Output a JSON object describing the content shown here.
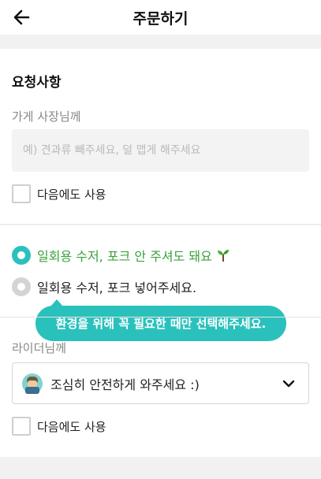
{
  "header": {
    "title": "주문하기",
    "back_icon": "arrow-left-icon"
  },
  "requests": {
    "section_title": "요청사항",
    "owner_label": "가게 사장님께",
    "owner_placeholder": "예) 견과류 빼주세요, 덜 맵게 해주세요",
    "owner_value": "",
    "owner_reuse_label": "다음에도 사용",
    "owner_reuse_checked": false
  },
  "utensils": {
    "options": [
      {
        "label": "일회용 수저, 포크 안 주셔도 돼요",
        "selected": true,
        "icon": "sprout-icon"
      },
      {
        "label": "일회용 수저, 포크 넣어주세요.",
        "selected": false
      }
    ],
    "tooltip": "환경을 위해 꼭 필요한 때만 선택해주세요."
  },
  "rider": {
    "label": "라이더님께",
    "selected_value": "조심히 안전하게 와주세요 :)",
    "avatar_icon": "rider-avatar-icon",
    "dropdown_icon": "chevron-down-icon",
    "reuse_label": "다음에도 사용",
    "reuse_checked": false
  },
  "colors": {
    "accent": "#2ac1bc",
    "eco_text": "#3ca23c",
    "section_gap": "#f1f1f1"
  }
}
